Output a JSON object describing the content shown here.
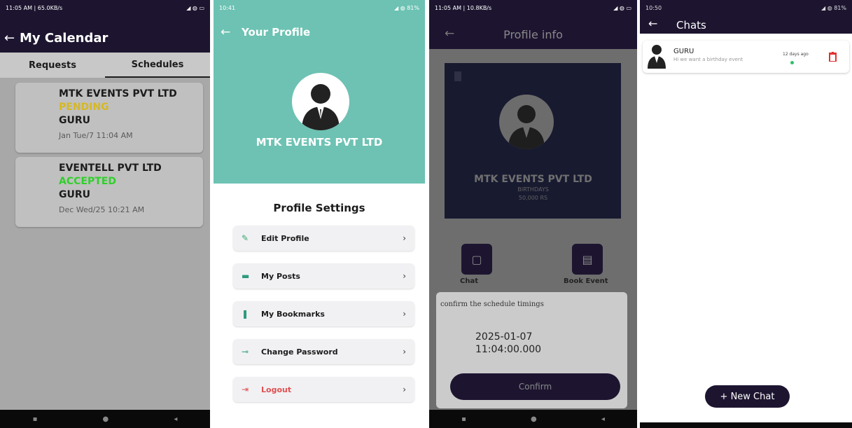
{
  "p1": {
    "status_left": "11:05 AM | 65.0KB/s",
    "status_right": "◢ ◍ ▭",
    "back": "←",
    "title": "My Calendar",
    "tabs": [
      "Requests",
      "Schedules"
    ],
    "cards": [
      {
        "company": "MTK EVENTS PVT LTD",
        "status": "PENDING",
        "status_color": "#d6b824",
        "name": "GURU",
        "date": "Jan Tue/7  11:04 AM"
      },
      {
        "company": "EVENTELL PVT LTD",
        "status": "ACCEPTED",
        "status_color": "#2fd02a",
        "name": "GURU",
        "date": "Dec Wed/25  10:21 AM"
      }
    ]
  },
  "p2": {
    "status_left": "10:41",
    "status_right": "◢ ◍ 81%",
    "back": "←",
    "title": "Your Profile",
    "company": "MTK EVENTS PVT LTD",
    "settings_title": "Profile Settings",
    "menu": [
      {
        "label": "Edit Profile",
        "icon": "edit-icon",
        "color": "#3aa86b",
        "glyph": "✎"
      },
      {
        "label": "My Posts",
        "icon": "posts-icon",
        "color": "#2e9a7d",
        "glyph": "▬"
      },
      {
        "label": "My Bookmarks",
        "icon": "bookmark-icon",
        "color": "#2e9a7d",
        "glyph": "❚"
      },
      {
        "label": "Change Password",
        "icon": "key-icon",
        "color": "#2e9a7d",
        "glyph": "⊸"
      },
      {
        "label": "Logout",
        "icon": "logout-icon",
        "color": "#e05050",
        "glyph": "⇥",
        "label_color": "#e05050"
      }
    ],
    "chevron": "›"
  },
  "p3": {
    "status_left": "11:05 AM | 10.8KB/s",
    "status_right": "◢ ◍ ▭",
    "back": "←",
    "title": "Profile info",
    "company": "MTK EVENTS PVT LTD",
    "category": "BIRTHDAYS",
    "price": "50,000 RS",
    "btn_left": "Chat",
    "btn_right": "Book Event",
    "dialog_title": "confirm the schedule timings",
    "date": "2025-01-07",
    "time": "11:04:00.000",
    "confirm": "Confirm"
  },
  "p4": {
    "status_left": "10:50",
    "status_right": "◢ ◍ 81%",
    "back": "←",
    "title": "Chats",
    "chat": {
      "name": "GURU",
      "message": "Hi we want a birthday event",
      "time": "12 days ago"
    },
    "new_chat": "+ New Chat"
  }
}
